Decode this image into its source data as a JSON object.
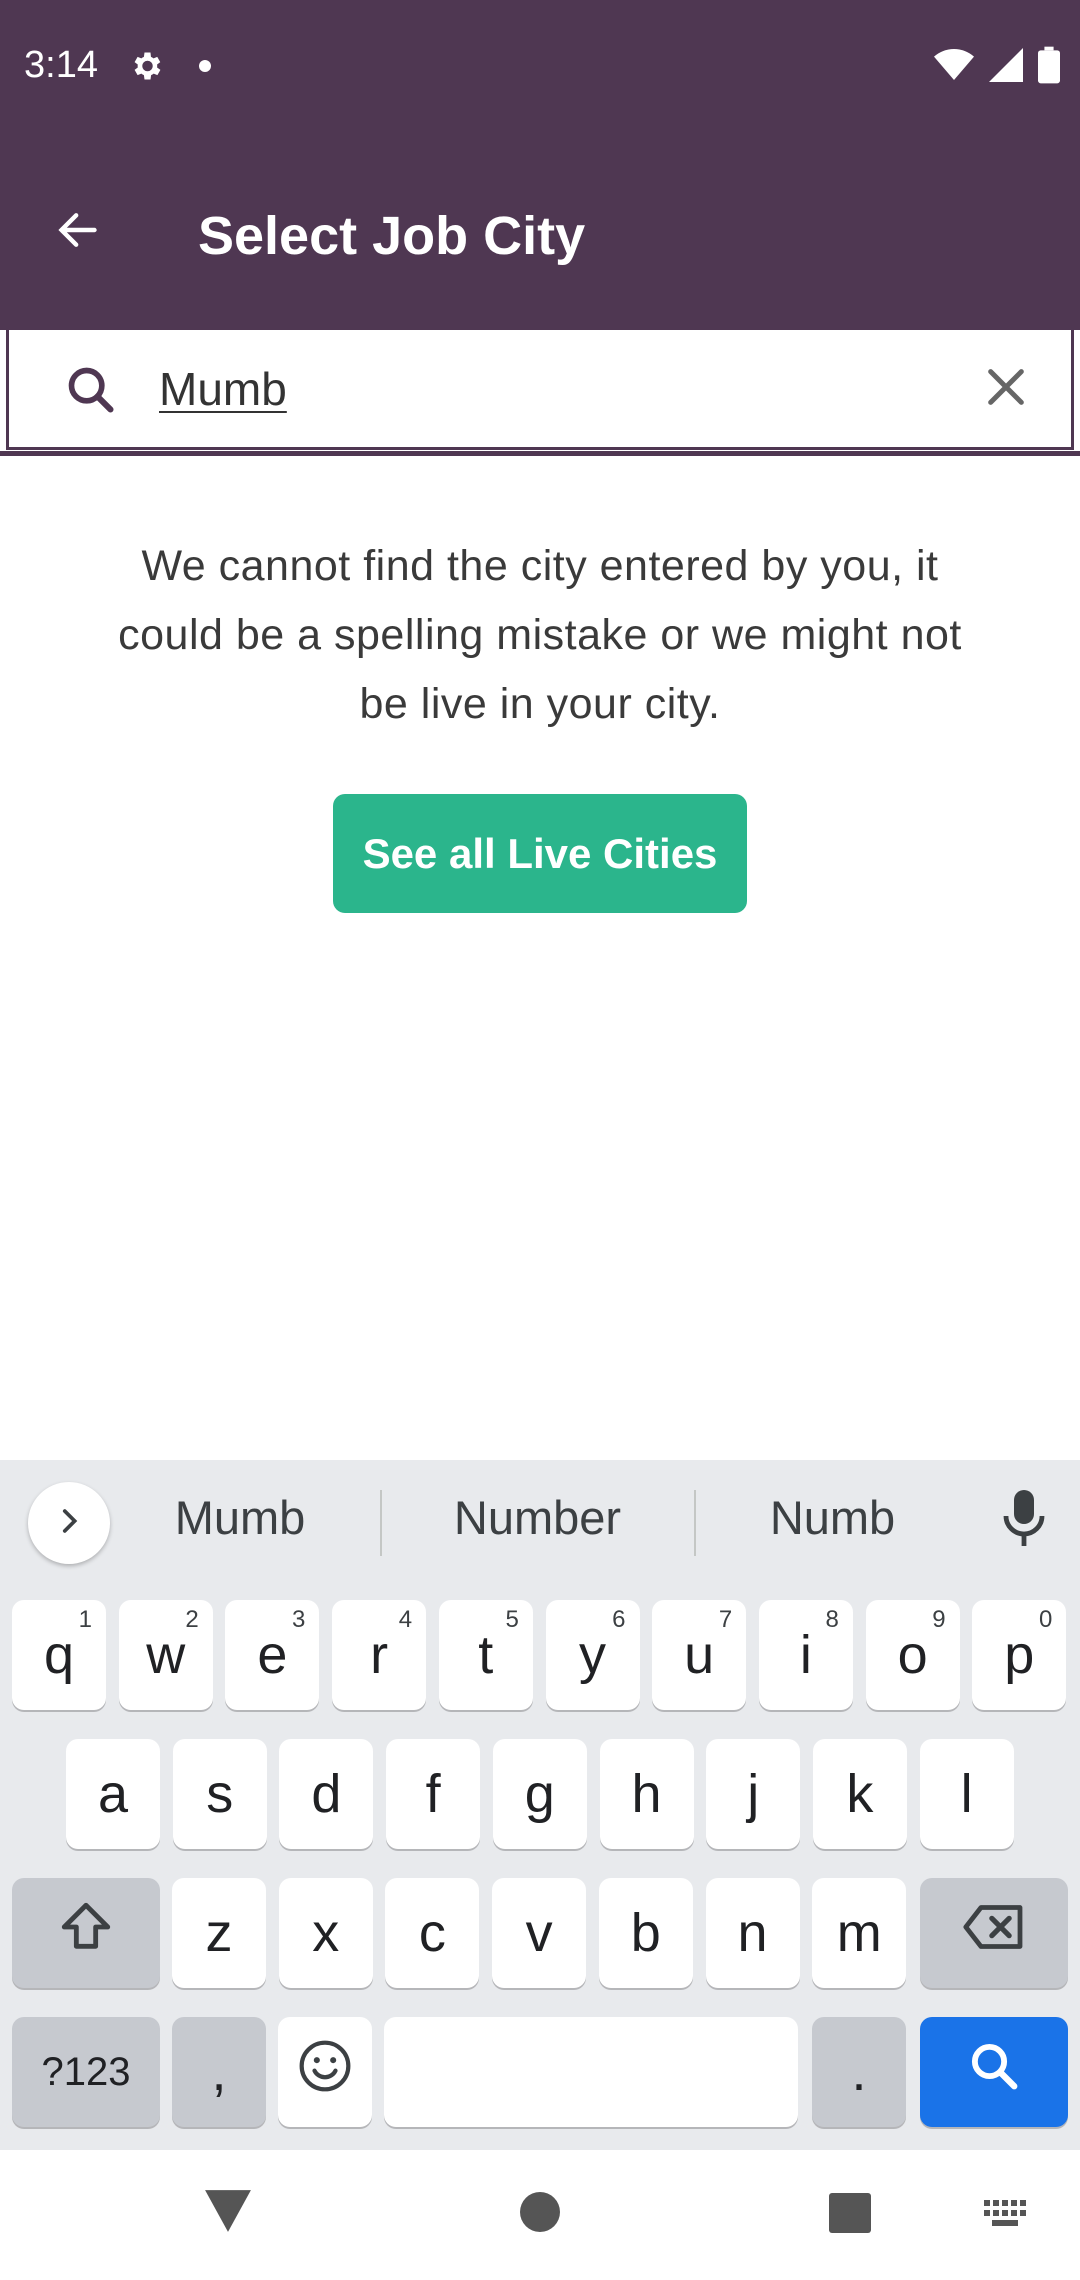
{
  "status_bar": {
    "time": "3:14"
  },
  "app_bar": {
    "title": "Select Job City"
  },
  "search": {
    "value": "Mumb",
    "placeholder": ""
  },
  "empty_state": {
    "message": "We cannot find the city entered by you, it could be a spelling mistake or we might not be live in your city.",
    "button_label": "See all Live Cities"
  },
  "keyboard": {
    "suggestions": [
      "Mumb",
      "Number",
      "Numb"
    ],
    "row1": [
      {
        "key": "q",
        "hint": "1"
      },
      {
        "key": "w",
        "hint": "2"
      },
      {
        "key": "e",
        "hint": "3"
      },
      {
        "key": "r",
        "hint": "4"
      },
      {
        "key": "t",
        "hint": "5"
      },
      {
        "key": "y",
        "hint": "6"
      },
      {
        "key": "u",
        "hint": "7"
      },
      {
        "key": "i",
        "hint": "8"
      },
      {
        "key": "o",
        "hint": "9"
      },
      {
        "key": "p",
        "hint": "0"
      }
    ],
    "row2": [
      "a",
      "s",
      "d",
      "f",
      "g",
      "h",
      "j",
      "k",
      "l"
    ],
    "row3": [
      "z",
      "x",
      "c",
      "v",
      "b",
      "n",
      "m"
    ],
    "symbols_label": "?123",
    "comma_label": ",",
    "period_label": "."
  },
  "colors": {
    "app_bar": "#4f3752",
    "cta": "#2bb58c",
    "search_key": "#1a73e8"
  },
  "icons": [
    "settings-icon",
    "wifi-icon",
    "signal-icon",
    "battery-icon",
    "back-arrow-icon",
    "search-icon",
    "close-icon",
    "chevron-right-icon",
    "mic-icon",
    "shift-icon",
    "backspace-icon",
    "emoji-icon",
    "nav-back-icon",
    "nav-home-icon",
    "nav-recents-icon",
    "keyboard-switch-icon"
  ]
}
